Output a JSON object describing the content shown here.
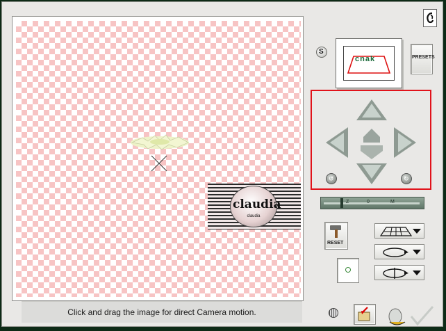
{
  "status": {
    "message": "Click and drag the image for direct Camera motion."
  },
  "preview": {
    "label": "claudia",
    "sublabel": "claudia"
  },
  "camera_thumb": {
    "label": "cnak"
  },
  "buttons": {
    "s_label": "S",
    "presets_label": "PRESETS",
    "reset_label": "RESET"
  },
  "slider": {
    "marks": [
      "Z",
      "0",
      "M"
    ]
  },
  "colors": {
    "highlight_border": "#e1121a",
    "checker_pink": "#f7c4c4"
  }
}
